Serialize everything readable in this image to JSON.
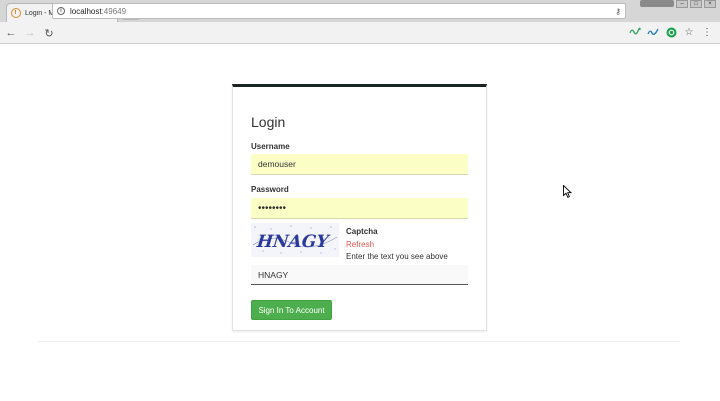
{
  "browser": {
    "tab_title": "Login - My ASP.NET Applic",
    "tab_close": "×",
    "url_host": "localhost",
    "url_port": ":49649",
    "profile_label": "",
    "back_glyph": "←",
    "forward_glyph": "→",
    "reload_glyph": "↻",
    "info_glyph": "i",
    "key_glyph": "⚷",
    "star_glyph": "☆",
    "menu_glyph": "⋮",
    "win_min": "–",
    "win_max": "□",
    "win_close": "×",
    "icons": [
      "back-icon",
      "forward-icon",
      "reload-icon",
      "info-icon",
      "key-icon",
      "extension-icon",
      "grammarly-icon",
      "star-icon",
      "menu-icon"
    ]
  },
  "login": {
    "title": "Login",
    "username_label": "Username",
    "username_value": "demouser",
    "password_label": "Password",
    "password_value": "demouser",
    "captcha_text": "HNAGY",
    "captcha_title": "Captcha",
    "captcha_refresh": "Refresh",
    "captcha_help": "Enter the text you see above",
    "captcha_input_value": "HNAGY",
    "submit_label": "Sign In To Account"
  },
  "colors": {
    "card_top_border": "#1a2424",
    "autofill_bg": "#fbffc6",
    "refresh_link": "#e8544a",
    "button_green": "#4cae4c",
    "captcha_text": "#2a3a9a"
  }
}
